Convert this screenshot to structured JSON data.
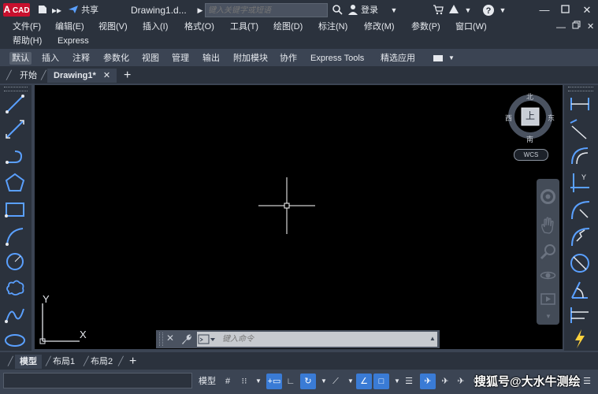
{
  "titlebar": {
    "logo_letter": "A",
    "logo_text": "CAD",
    "share_label": "共享",
    "document_title": "Drawing1.d...",
    "search_placeholder": "键入关键字或短语",
    "login_label": "登录"
  },
  "menubar": {
    "row1": [
      "文件(F)",
      "编辑(E)",
      "视图(V)",
      "插入(I)",
      "格式(O)",
      "工具(T)",
      "绘图(D)",
      "标注(N)",
      "修改(M)",
      "参数(P)",
      "窗口(W)"
    ],
    "row2": [
      "帮助(H)",
      "Express"
    ]
  },
  "ribbon_tabs": [
    "默认",
    "插入",
    "注释",
    "参数化",
    "视图",
    "管理",
    "输出",
    "附加模块",
    "协作",
    "Express Tools",
    "精选应用"
  ],
  "doc_tabs": {
    "start": "开始",
    "active": "Drawing1*"
  },
  "viewcube": {
    "north": "北",
    "south": "南",
    "east": "东",
    "west": "西",
    "face": "上",
    "wcs": "WCS"
  },
  "ucs": {
    "x_label": "X",
    "y_label": "Y"
  },
  "command_line": {
    "placeholder": "键入命令"
  },
  "layout_tabs": [
    "模型",
    "布局1",
    "布局2"
  ],
  "statusbar": {
    "model_label": "模型"
  },
  "watermark": "搜狐号@大水牛测绘",
  "colors": {
    "accent": "#3a7bd5",
    "logo_red": "#c8102e",
    "toolbar_icon": "#5aa0ff",
    "canvas": "#000000"
  }
}
